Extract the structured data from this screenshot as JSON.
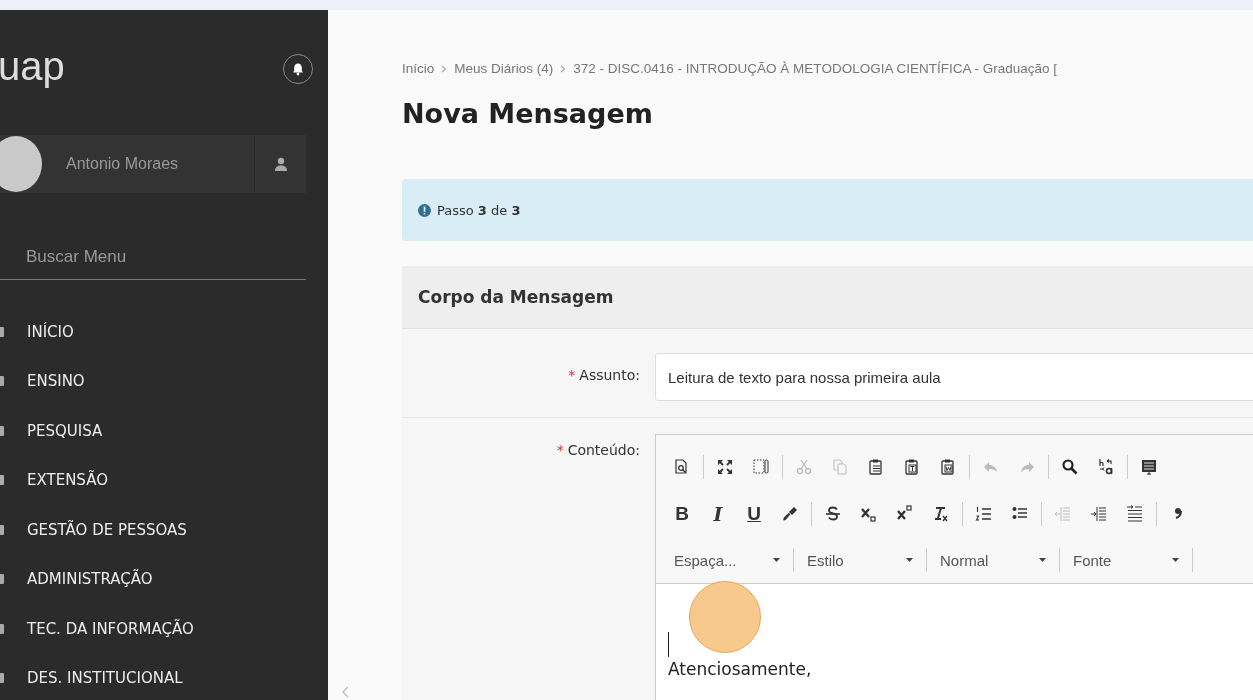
{
  "sidebar": {
    "logo": "uap",
    "user": {
      "name": "Antonio Moraes"
    },
    "search": {
      "placeholder": "Buscar Menu"
    },
    "items": [
      {
        "label": "INÍCIO"
      },
      {
        "label": "ENSINO"
      },
      {
        "label": "PESQUISA"
      },
      {
        "label": "EXTENSÃO"
      },
      {
        "label": "GESTÃO DE PESSOAS"
      },
      {
        "label": "ADMINISTRAÇÃO"
      },
      {
        "label": "TEC. DA INFORMAÇÃO"
      },
      {
        "label": "DES. INSTITUCIONAL"
      }
    ]
  },
  "breadcrumb": [
    "Início",
    "Meus Diários (4)",
    "372 - DISC.0416 - INTRODUÇÃO À METODOLOGIA CIENTÍFICA - Graduação ["
  ],
  "title": "Nova Mensagem",
  "step": {
    "prefix": "Passo ",
    "current": "3",
    "middle": " de ",
    "total": "3"
  },
  "panel": {
    "title": "Corpo da Mensagem",
    "fields": [
      {
        "kind": "input",
        "required_mark": "*",
        "label": "Assunto:",
        "value": "Leitura de texto para nossa primeira aula"
      },
      {
        "kind": "editor",
        "required_mark": "*",
        "label": "Conteúdo:"
      }
    ]
  },
  "editor": {
    "toolbar_rows": [
      [
        [
          {
            "kind": "preview",
            "disabled": false
          }
        ],
        [
          {
            "kind": "maximize",
            "disabled": false
          },
          {
            "kind": "blocks",
            "disabled": false
          }
        ],
        [
          {
            "kind": "cut",
            "disabled": true
          },
          {
            "kind": "copy",
            "disabled": true
          },
          {
            "kind": "paste",
            "disabled": false
          },
          {
            "kind": "paste-text",
            "disabled": false
          },
          {
            "kind": "paste-word",
            "disabled": false
          }
        ],
        [
          {
            "kind": "undo",
            "disabled": true
          },
          {
            "kind": "redo",
            "disabled": true
          }
        ],
        [
          {
            "kind": "find",
            "disabled": false
          },
          {
            "kind": "replace",
            "disabled": false
          }
        ],
        [
          {
            "kind": "template",
            "disabled": false
          }
        ]
      ],
      [
        [
          {
            "kind": "bold",
            "label": "B",
            "disabled": false
          },
          {
            "kind": "italic",
            "label": "I",
            "disabled": false
          },
          {
            "kind": "underline",
            "label": "U",
            "disabled": false
          },
          {
            "kind": "brush",
            "disabled": false
          }
        ],
        [
          {
            "kind": "strike",
            "disabled": false
          },
          {
            "kind": "subscript",
            "disabled": false
          },
          {
            "kind": "superscript",
            "disabled": false
          },
          {
            "kind": "clear-format",
            "disabled": false
          }
        ],
        [
          {
            "kind": "numbered-list",
            "disabled": false
          },
          {
            "kind": "bulleted-list",
            "disabled": false
          }
        ],
        [
          {
            "kind": "outdent",
            "disabled": true
          },
          {
            "kind": "indent",
            "disabled": false
          },
          {
            "kind": "first-indent",
            "disabled": false
          }
        ],
        [
          {
            "kind": "quote",
            "disabled": false
          }
        ]
      ]
    ],
    "dropdowns": [
      {
        "label": "Espaça..."
      },
      {
        "label": "Estilo"
      },
      {
        "label": "Normal"
      },
      {
        "label": "Fonte"
      }
    ],
    "content": [
      "Atenciosamente,"
    ]
  }
}
